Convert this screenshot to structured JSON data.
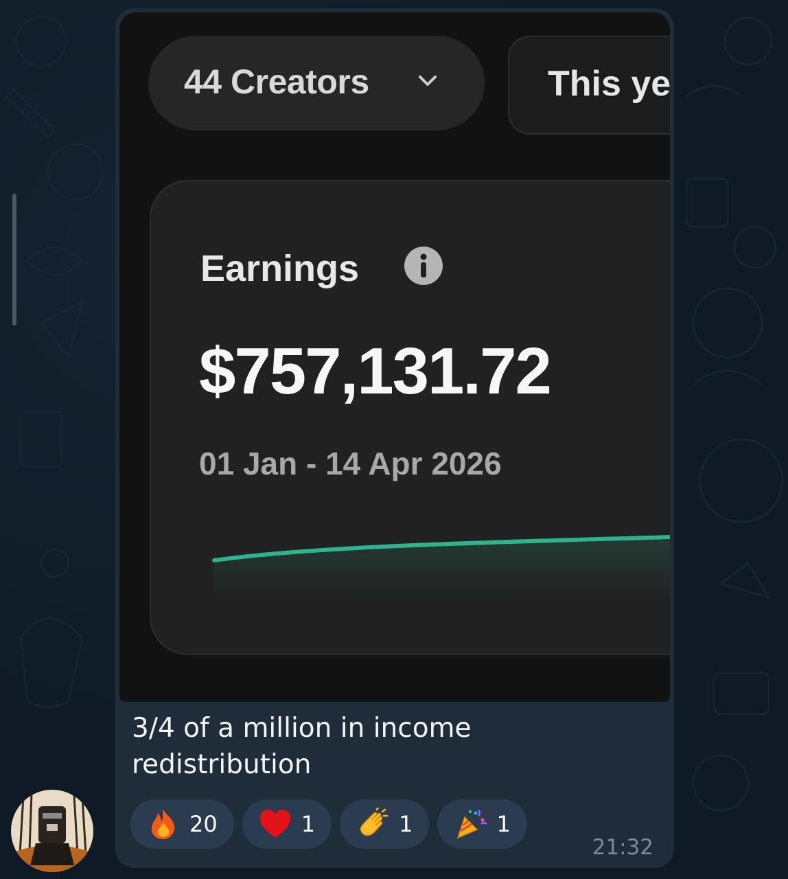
{
  "media": {
    "creators_filter": "44 Creators",
    "period_filter": "This ye",
    "earnings": {
      "title": "Earnings",
      "amount": "$757,131.72",
      "range": "01 Jan - 14 Apr 2026"
    }
  },
  "message": {
    "caption": "3/4 of a million in income redistribution",
    "time": "21:32"
  },
  "reactions": [
    {
      "emoji": "fire-emoji",
      "count": "20"
    },
    {
      "emoji": "heart-emoji",
      "count": "1"
    },
    {
      "emoji": "clapping-hands-emoji",
      "count": "1"
    },
    {
      "emoji": "party-popper-emoji",
      "count": "1"
    }
  ],
  "colors": {
    "bubble": "#1f2c3a",
    "reaction_bg": "#2b3c50",
    "chart_line": "#2fb38a",
    "chat_bg": "#0f1a26"
  }
}
